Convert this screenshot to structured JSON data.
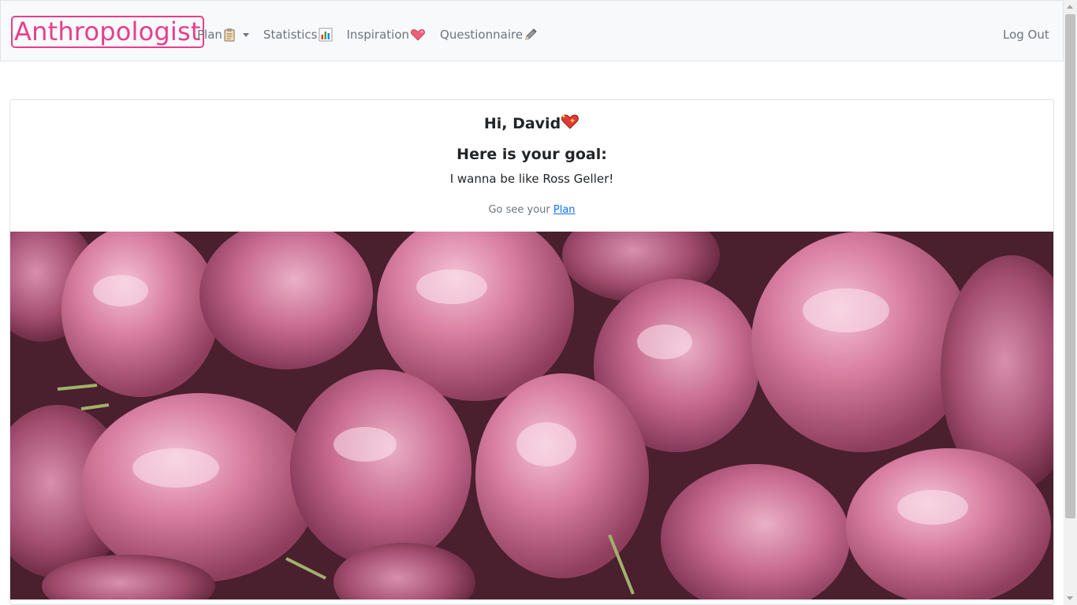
{
  "navbar": {
    "brand": "Anthropologist",
    "links": [
      {
        "label": "Plan",
        "icon": "clipboard-icon",
        "has_dropdown": true
      },
      {
        "label": "Statistics",
        "icon": "bar-chart-icon"
      },
      {
        "label": "Inspiration",
        "icon": "heart-icon"
      },
      {
        "label": "Questionnaire",
        "icon": "pencil-icon"
      }
    ],
    "logout": "Log Out"
  },
  "card": {
    "greeting": "Hi, David",
    "goal_heading": "Here is your goal:",
    "goal_text": "I wanna be like Ross Geller!",
    "go_see_prefix": "Go see your",
    "go_see_link": "Plan"
  },
  "colors": {
    "brand": "#e83e8c",
    "navbar_bg": "#f8f9fa",
    "link": "#0d6efd",
    "muted": "#6c757d"
  }
}
